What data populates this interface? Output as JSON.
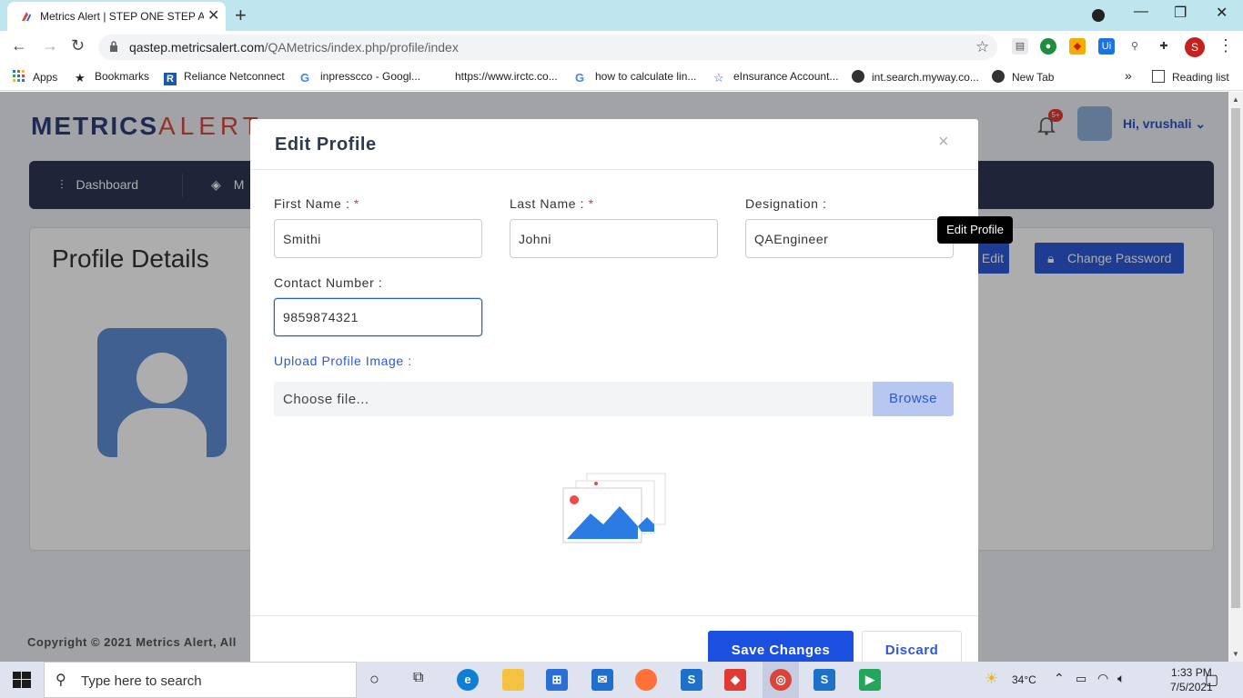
{
  "browser": {
    "tab_title": "Metrics Alert | STEP ONE STEP AH",
    "url_domain": "qastep.metricsalert.com",
    "url_path": "/QAMetrics/index.php/profile/index",
    "bookmarks": [
      {
        "label": "Apps",
        "icon": "apps-grid-icon"
      },
      {
        "label": "Bookmarks",
        "icon": "star-icon"
      },
      {
        "label": "Reliance Netconnect",
        "icon": "reliance-r-icon"
      },
      {
        "label": "inpresscco - Googl...",
        "icon": "google-g-icon"
      },
      {
        "label": "https://www.irctc.co...",
        "icon": ""
      },
      {
        "label": "how to calculate lin...",
        "icon": "google-g-icon"
      },
      {
        "label": "eInsurance Account...",
        "icon": "einsurance-icon"
      },
      {
        "label": "int.search.myway.co...",
        "icon": "globe-icon"
      },
      {
        "label": "New Tab",
        "icon": "globe-icon"
      }
    ],
    "reading_list": "Reading list",
    "overflow_chevron": "»",
    "profile_initial": "S"
  },
  "app": {
    "logo_metrics": "METRICS",
    "logo_alert": "ALERT",
    "notification_badge": "5+",
    "greeting": "Hi, vrushali",
    "nav": [
      "Dashboard",
      "M"
    ],
    "page_title": "Profile Details",
    "edit_button": "Edit",
    "change_password_button": "Change Password",
    "copyright": "Copyright © 2021 Metrics Alert, All"
  },
  "modal": {
    "title": "Edit Profile",
    "close": "×",
    "first_name_label": "First Name : ",
    "last_name_label": "Last Name : ",
    "designation_label": "Designation :",
    "contact_label": "Contact Number :",
    "required_mark": "*",
    "first_name_value": "Smithi",
    "last_name_value": "Johni",
    "designation_value": "QAEngineer",
    "contact_value": "9859874321",
    "upload_label": "Upload Profile Image :",
    "file_placeholder": "Choose file...",
    "browse_label": "Browse",
    "save_label": "Save Changes",
    "discard_label": "Discard"
  },
  "tooltip": "Edit Profile",
  "taskbar": {
    "search_placeholder": "Type here to search",
    "temperature": "34°C",
    "time": "1:33 PM",
    "date": "7/5/2021"
  },
  "colors": {
    "accent": "#2b59d8",
    "navbar": "#2e3553",
    "logo_red": "#d84a3c",
    "required_red": "#e53935"
  }
}
